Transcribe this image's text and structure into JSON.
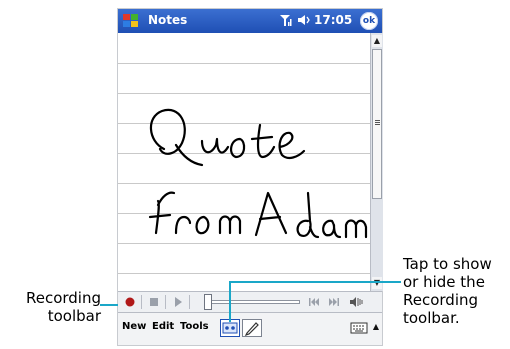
{
  "titlebar": {
    "app_title": "Notes",
    "time": "17:05",
    "ok_label": "ok"
  },
  "note": {
    "handwriting_lines": [
      "Quote",
      "from Adam"
    ]
  },
  "menubar": {
    "items": [
      "New",
      "Edit",
      "Tools"
    ]
  },
  "callouts": {
    "left": "Recording toolbar",
    "right": "Tap to show or hide the Recording toolbar."
  },
  "colors": {
    "titlebar": "#2957c3",
    "record_button": "#b01818",
    "callout_line": "#1aa7c8"
  }
}
